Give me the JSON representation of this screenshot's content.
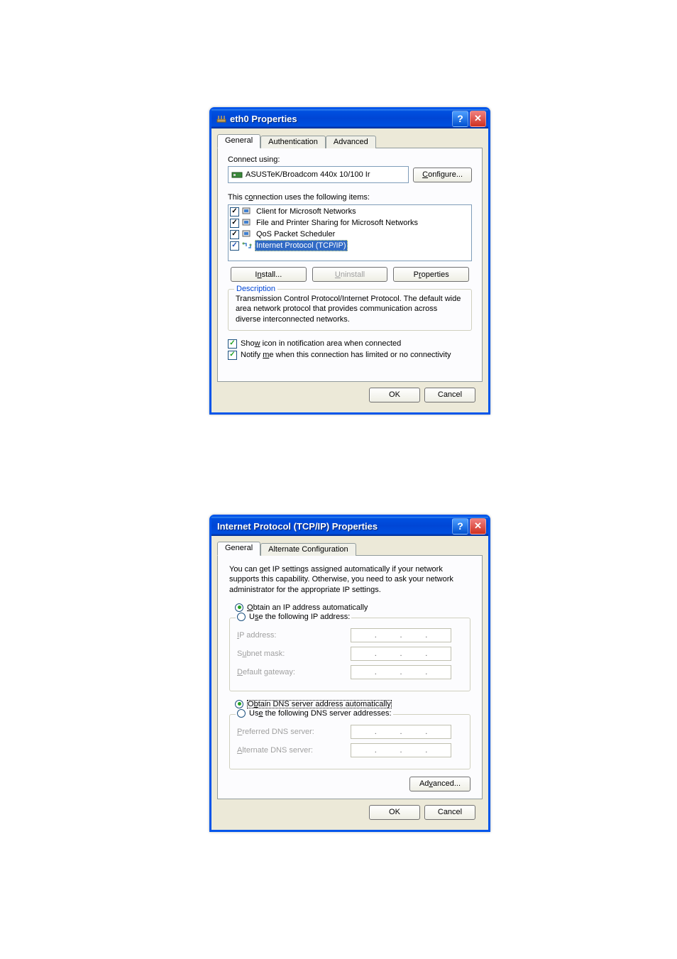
{
  "dialog1": {
    "title": "eth0 Properties",
    "tabs": [
      "General",
      "Authentication",
      "Advanced"
    ],
    "connect_using_label": "Connect using:",
    "adapter": "ASUSTeK/Broadcom 440x 10/100 Ir",
    "configure_btn": "Configure...",
    "items_label": "This connection uses the following items:",
    "items": [
      {
        "label": "Client for Microsoft Networks",
        "checked": true
      },
      {
        "label": "File and Printer Sharing for Microsoft Networks",
        "checked": true
      },
      {
        "label": "QoS Packet Scheduler",
        "checked": true
      },
      {
        "label": "Internet Protocol (TCP/IP)",
        "checked": true,
        "selected": true
      }
    ],
    "install_btn": "Install...",
    "uninstall_btn": "Uninstall",
    "properties_btn": "Properties",
    "description_label": "Description",
    "description_text": "Transmission Control Protocol/Internet Protocol. The default wide area network protocol that provides communication across diverse interconnected networks.",
    "show_icon_label": "Show icon in notification area when connected",
    "notify_label": "Notify me when this connection has limited or no connectivity",
    "ok_btn": "OK",
    "cancel_btn": "Cancel"
  },
  "dialog2": {
    "title": "Internet Protocol (TCP/IP) Properties",
    "tabs": [
      "General",
      "Alternate Configuration"
    ],
    "intro": "You can get IP settings assigned automatically if your network supports this capability. Otherwise, you need to ask your network administrator for the appropriate IP settings.",
    "radio_auto_ip": "Obtain an IP address automatically",
    "radio_static_ip": "Use the following IP address:",
    "ip_label": "IP address:",
    "subnet_label": "Subnet mask:",
    "gateway_label": "Default gateway:",
    "radio_auto_dns": "Obtain DNS server address automatically",
    "radio_static_dns": "Use the following DNS server addresses:",
    "pref_dns_label": "Preferred DNS server:",
    "alt_dns_label": "Alternate DNS server:",
    "advanced_btn": "Advanced...",
    "ok_btn": "OK",
    "cancel_btn": "Cancel"
  }
}
